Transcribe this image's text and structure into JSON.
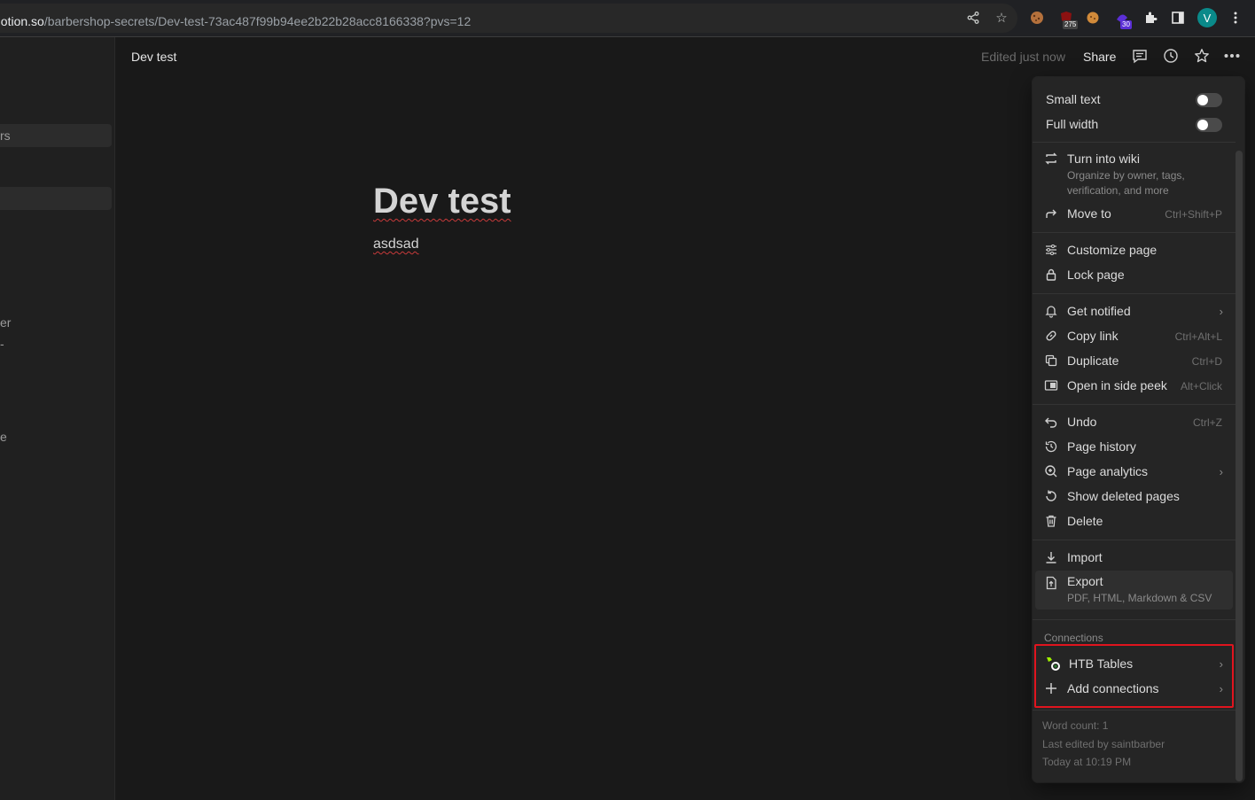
{
  "browser": {
    "url_host": "notion.so",
    "url_path": "/barbershop-secrets/Dev-test-73ac487f99b94ee2b22b28acc8166338?pvs=12",
    "badge_1": "275",
    "badge_2": "30",
    "avatar_letter": "V"
  },
  "sidebar": {
    "fragments": [
      "rs",
      "er",
      "-",
      "e"
    ]
  },
  "header": {
    "title": "Dev test",
    "edited": "Edited just now",
    "share_label": "Share"
  },
  "page": {
    "title": "Dev test",
    "body": "asdsad"
  },
  "menu": {
    "small_text": "Small text",
    "full_width": "Full width",
    "turn_into_wiki": "Turn into wiki",
    "turn_into_wiki_desc_1": "Organize by owner, tags,",
    "turn_into_wiki_desc_2": "verification, and more",
    "move_to": "Move to",
    "move_to_shortcut": "Ctrl+Shift+P",
    "customize_page": "Customize page",
    "lock_page": "Lock page",
    "get_notified": "Get notified",
    "copy_link": "Copy link",
    "copy_link_shortcut": "Ctrl+Alt+L",
    "duplicate": "Duplicate",
    "duplicate_shortcut": "Ctrl+D",
    "open_side_peek": "Open in side peek",
    "open_side_peek_shortcut": "Alt+Click",
    "undo": "Undo",
    "undo_shortcut": "Ctrl+Z",
    "page_history": "Page history",
    "page_analytics": "Page analytics",
    "show_deleted": "Show deleted pages",
    "delete": "Delete",
    "import": "Import",
    "export": "Export",
    "export_desc": "PDF, HTML, Markdown & CSV",
    "connections_heading": "Connections",
    "htb_tables": "HTB Tables",
    "add_connections": "Add connections",
    "word_count": "Word count: 1",
    "last_edited_by": "Last edited by saintbarber",
    "last_edited_time": "Today at 10:19 PM"
  },
  "colors": {
    "highlight": "#e0141e",
    "background": "#191919",
    "menu_bg": "#252525"
  }
}
